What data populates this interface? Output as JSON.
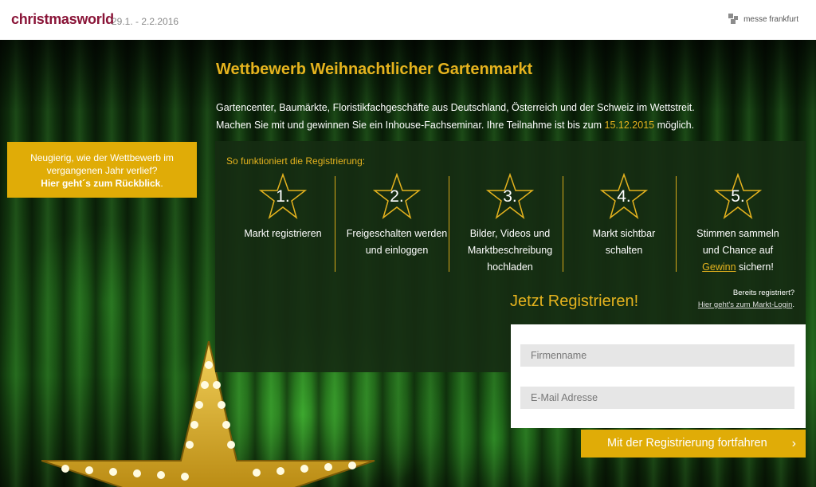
{
  "header": {
    "brand": "christmasworld",
    "dates": "29.1. - 2.2.2016",
    "partner": "messe frankfurt"
  },
  "main": {
    "title": "Wettbewerb Weihnachtlicher Gartenmarkt",
    "intro_line1": "Gartencenter, Baumärkte, Floristikfachgeschäfte aus Deutschland, Österreich und der Schweiz im Wettstreit.",
    "intro_line2_pre": "Machen Sie mit und gewinnen Sie ein Inhouse-Fachseminar. Ihre Teilnahme ist bis zum ",
    "intro_deadline": "15.12.2015",
    "intro_line2_post": " möglich."
  },
  "review": {
    "line1": "Neugierig, wie der Wettbewerb im",
    "line2": "vergangenen Jahr verlief?",
    "link": "Hier geht´s zum Rückblick",
    "suffix": "."
  },
  "steps": {
    "title": "So funktioniert die Registrierung:",
    "items": [
      {
        "num": "1.",
        "l1": "Markt registrieren"
      },
      {
        "num": "2.",
        "l1": "Freigeschalten werden",
        "l2": "und einloggen"
      },
      {
        "num": "3.",
        "l1": "Bilder, Videos und",
        "l2": "Marktbeschreibung",
        "l3": "hochladen"
      },
      {
        "num": "4.",
        "l1": "Markt sichtbar",
        "l2": "schalten"
      },
      {
        "num": "5.",
        "l1": "Stimmen sammeln",
        "l2": "und Chance auf",
        "l3_link": "Gewinn",
        "l3_post": " sichern!"
      }
    ]
  },
  "register": {
    "cta": "Jetzt Registrieren!",
    "already": "Bereits registriert?",
    "login_link": "Hier geht's zum Markt-Login",
    "login_suffix": ".",
    "company_placeholder": "Firmenname",
    "email_placeholder": "E-Mail Adresse",
    "submit": "Mit der Registrierung fortfahren",
    "submit_icon": "chevron-right-icon"
  },
  "colors": {
    "accent": "#e0ac07",
    "brand": "#8a1538"
  }
}
